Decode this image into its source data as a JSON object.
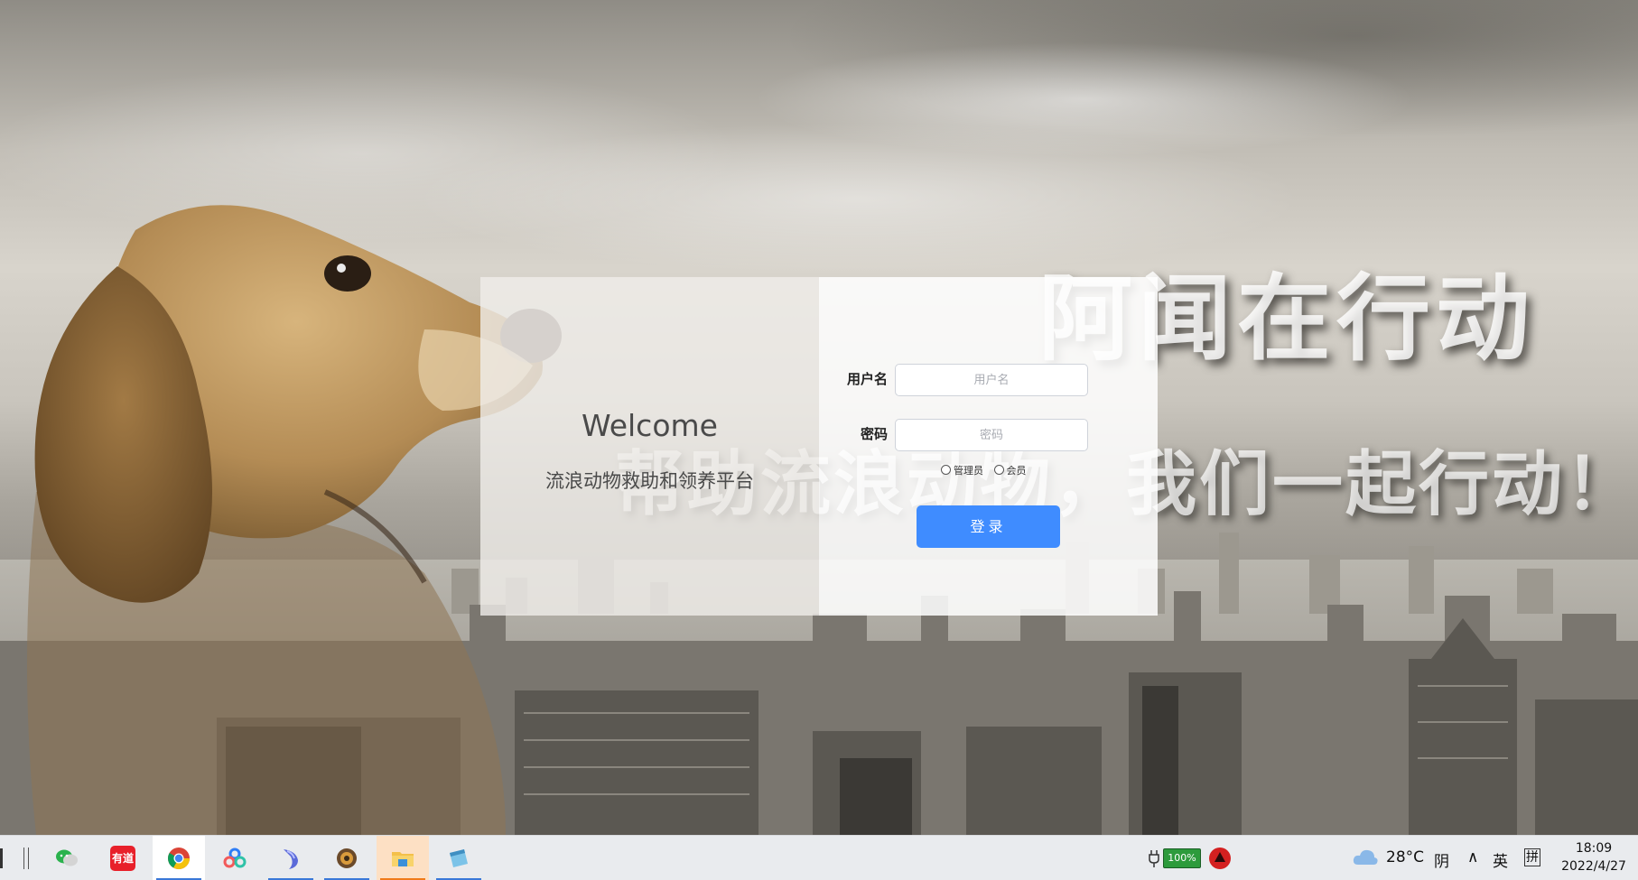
{
  "background": {
    "slogan_title": "阿闻在行动",
    "slogan_sub": "帮助流浪动物，我们一起行动！"
  },
  "login": {
    "welcome": "Welcome",
    "subtitle": "流浪动物救助和领养平台",
    "username_label": "用户名",
    "username_placeholder": "用户名",
    "username_value": "",
    "password_label": "密码",
    "password_placeholder": "密码",
    "password_value": "",
    "roles": [
      {
        "label": "管理员",
        "selected": false
      },
      {
        "label": "会员",
        "selected": false
      }
    ],
    "submit_label": "登录",
    "accent_color": "#3f8cff"
  },
  "taskbar": {
    "apps": [
      {
        "name": "wechat",
        "icon": "wechat-icon"
      },
      {
        "name": "youdao",
        "icon": "youdao-icon",
        "text": "有道"
      },
      {
        "name": "chrome",
        "icon": "chrome-icon",
        "state": "open"
      },
      {
        "name": "baidu-netdisk",
        "icon": "baidu-netdisk-icon"
      },
      {
        "name": "pycharm",
        "icon": "dolphin-icon",
        "state": "open"
      },
      {
        "name": "tool",
        "icon": "gear-icon",
        "state": "open"
      },
      {
        "name": "file-explorer",
        "icon": "folder-icon",
        "state": "active"
      },
      {
        "name": "typora",
        "icon": "notepad-icon",
        "state": "open"
      }
    ],
    "tray": {
      "battery": "100%",
      "weather_temp": "28°C",
      "weather_desc": "阴",
      "ime_lang": "英",
      "ime_mode": "拼",
      "time": "18:09",
      "date": "2022/4/27"
    }
  }
}
